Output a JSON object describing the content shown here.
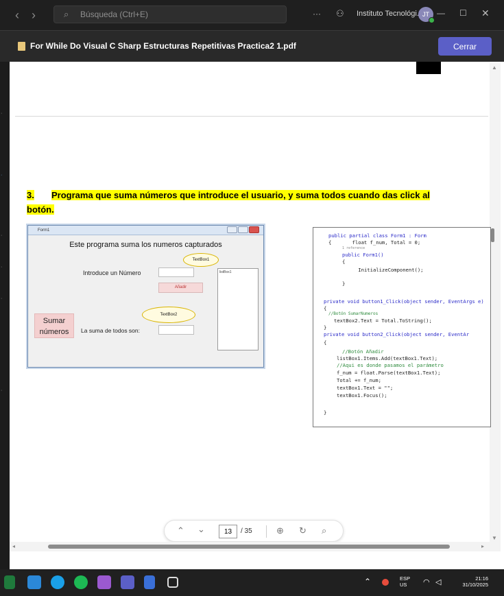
{
  "titlebar": {
    "search_placeholder": "Búsqueda (Ctrl+E)",
    "org_name": "Instituto Tecnológi...",
    "avatar_initials": "JT",
    "more": "···"
  },
  "pdf": {
    "filename": "For While Do Visual C Sharp Estructuras Repetitivas Practica2 1.pdf",
    "close_label": "Cerrar"
  },
  "document": {
    "section_number": "3.",
    "section_title_line1": "Programa que suma números que introduce el usuario, y suma todos cuando das click al",
    "section_title_line2": "botón.",
    "form": {
      "window_title": "Form1",
      "heading": "Este programa suma los numeros capturados",
      "textbox1_label": "TextBox1",
      "input_label": "Introduce un Número",
      "add_button": "Añadir",
      "listbox_label": "listBox1",
      "textbox2_label": "TextBox2",
      "sum_button_line1": "Sumar",
      "sum_button_line2": "números",
      "sum_label": "La suma de todos son:"
    },
    "code_lines": [
      "public partial class Form1 : Form",
      "{       float f_num, Total = 0;",
      "1 reference",
      "public Form1()",
      "{",
      "    InitializeComponent();",
      "}",
      "private void button1_Click(object sender, EventArgs e)",
      "{",
      "//Botón SumarNumeros",
      "textBox2.Text = Total.ToString();",
      "}",
      "private void button2_Click(object sender, EventAr",
      "{",
      "//Botón Añadir",
      "listBox1.Items.Add(textBox1.Text);",
      "//Aqui es donde pasamos el parámetro",
      "f_num = float.Parse(textBox1.Text);",
      "Total += f_num;",
      "textBox1.Text = \"\";",
      "textBox1.Focus();",
      "}"
    ]
  },
  "toolbar": {
    "current_page": "13",
    "total_pages": "/ 35"
  },
  "taskbar": {
    "lang_line1": "ESP",
    "lang_line2": "US",
    "time": "21:16",
    "date": "31/10/2025"
  }
}
